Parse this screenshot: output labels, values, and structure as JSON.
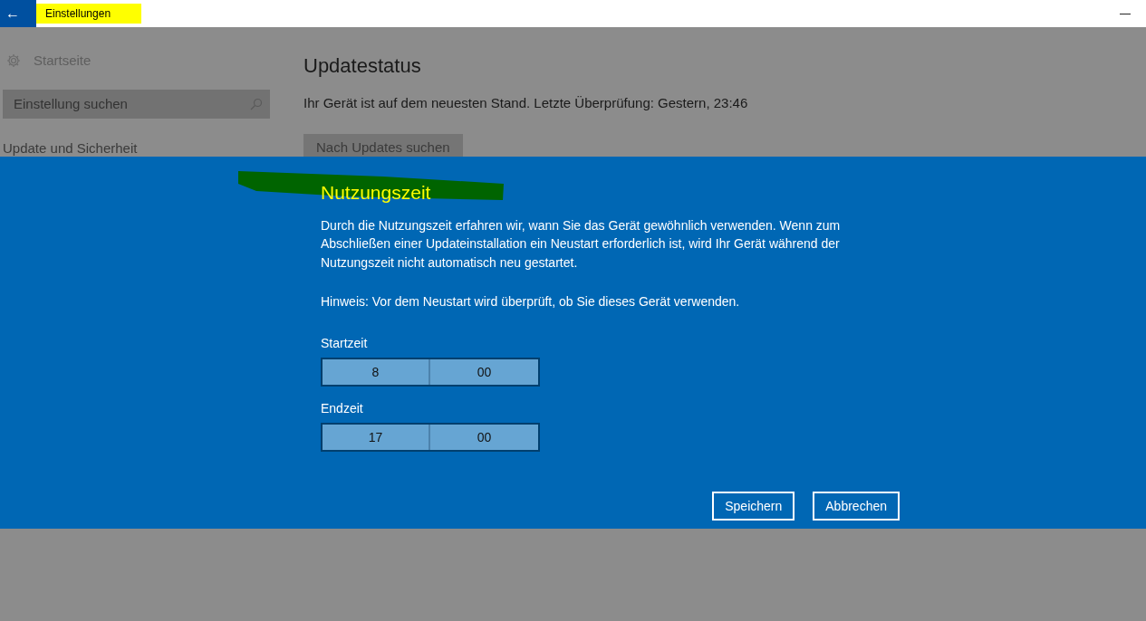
{
  "window": {
    "title": "Einstellungen",
    "back": "←",
    "minimize": "—"
  },
  "sidebar": {
    "home": "Startseite",
    "search": {
      "placeholder": "Einstellung suchen"
    },
    "section": "Update und Sicherheit"
  },
  "main": {
    "heading": "Updatestatus",
    "status": "Ihr Gerät ist auf dem neuesten Stand. Letzte Überprüfung: Gestern, 23:46",
    "button": "Nach Updates suchen"
  },
  "dialog": {
    "title": "Nutzungszeit",
    "description": "Durch die Nutzungszeit erfahren wir, wann Sie das Gerät gewöhnlich verwenden. Wenn zum Abschließen einer Updateinstallation ein Neustart erforderlich ist, wird Ihr Gerät während der Nutzungszeit nicht automatisch neu gestartet.",
    "hint": "Hinweis: Vor dem Neustart wird überprüft, ob Sie dieses Gerät verwenden.",
    "times": [
      {
        "label": "Startzeit",
        "hour": "8",
        "minute": "00"
      },
      {
        "label": "Endzeit",
        "hour": "17",
        "minute": "00"
      }
    ],
    "buttons": [
      "Speichern",
      "Abbrechen"
    ]
  }
}
